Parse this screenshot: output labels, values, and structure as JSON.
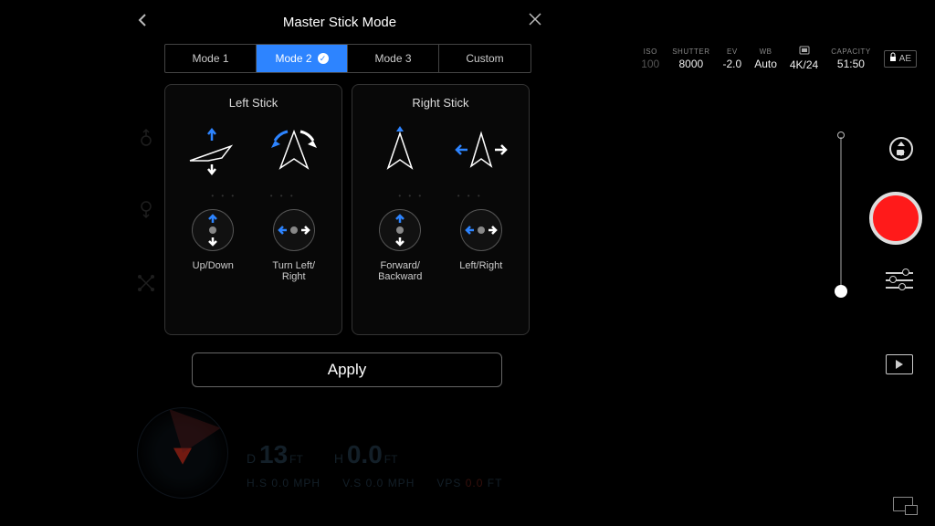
{
  "header": {
    "title": "Master Stick Mode"
  },
  "tabs": [
    {
      "label": "Mode 1",
      "active": false
    },
    {
      "label": "Mode 2",
      "active": true
    },
    {
      "label": "Mode 3",
      "active": false
    },
    {
      "label": "Custom",
      "active": false
    }
  ],
  "left_stick": {
    "title": "Left Stick",
    "control1_label": "Up/Down",
    "control2_label": "Turn Left/\nRight"
  },
  "right_stick": {
    "title": "Right Stick",
    "control1_label": "Forward/\nBackward",
    "control2_label": "Left/Right"
  },
  "apply_label": "Apply",
  "camera_status": {
    "iso": {
      "label": "ISO",
      "value": "100"
    },
    "shutter": {
      "label": "SHUTTER",
      "value": "8000"
    },
    "ev": {
      "label": "EV",
      "value": "-2.0"
    },
    "wb": {
      "label": "WB",
      "value": "Auto"
    },
    "format": {
      "label": "",
      "value": "4K/24"
    },
    "capacity": {
      "label": "CAPACITY",
      "value": "51:50"
    },
    "ae": "AE"
  },
  "telemetry": {
    "d_label": "D",
    "d_val": "13",
    "d_unit": "FT",
    "h_label": "H",
    "h_val": "0.0",
    "h_unit": "FT",
    "hs_label": "H.S",
    "hs_val": "0.0",
    "hs_unit": "MPH",
    "vs_label": "V.S",
    "vs_val": "0.0",
    "vs_unit": "MPH",
    "vps_label": "VPS",
    "vps_val": "0.0",
    "vps_unit": "FT"
  }
}
